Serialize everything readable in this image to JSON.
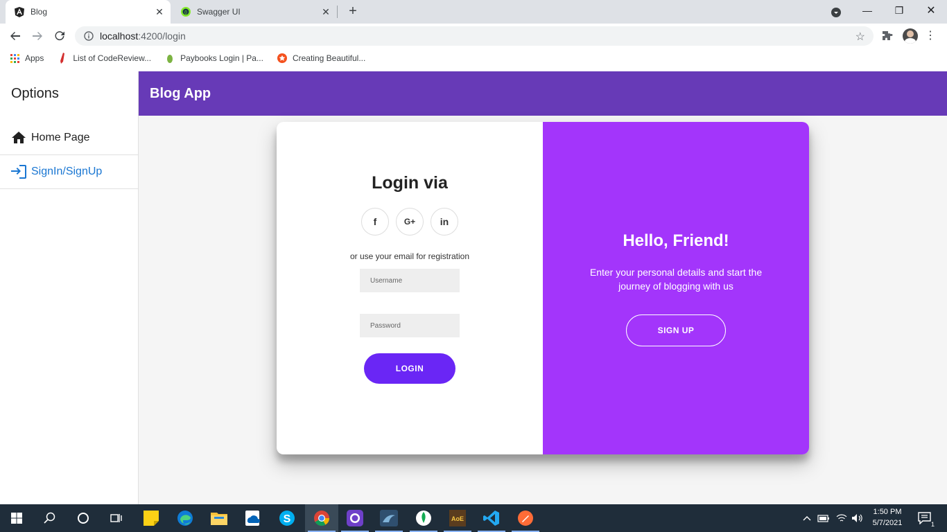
{
  "browser": {
    "tabs": [
      {
        "title": "Blog",
        "icon": "angular-icon",
        "active": true
      },
      {
        "title": "Swagger UI",
        "icon": "swagger-icon",
        "active": false
      }
    ],
    "url_host": "localhost",
    "url_path": ":4200/login",
    "bookmarks": [
      {
        "label": "Apps",
        "icon": "apps-grid-icon"
      },
      {
        "label": "List of CodeReview...",
        "icon": "red-pen-icon"
      },
      {
        "label": "Paybooks Login | Pa...",
        "icon": "leaf-icon"
      },
      {
        "label": "Creating Beautiful...",
        "icon": "star-badge-icon"
      }
    ]
  },
  "sidebar": {
    "title": "Options",
    "items": [
      {
        "label": "Home Page",
        "icon": "home-icon",
        "active": false
      },
      {
        "label": "SignIn/SignUp",
        "icon": "login-icon",
        "active": true
      }
    ]
  },
  "appbar": {
    "title": "Blog App"
  },
  "login": {
    "title": "Login via",
    "social": [
      "f",
      "G+",
      "in"
    ],
    "hint": "or use your email for registration",
    "username_placeholder": "Username",
    "password_placeholder": "Password",
    "button": "LOGIN"
  },
  "overlay": {
    "title": "Hello, Friend!",
    "text": "Enter your personal details and start the journey of blogging with us",
    "button": "SIGN UP"
  },
  "taskbar": {
    "time": "1:50 PM",
    "date": "5/7/2021",
    "notifications": "1"
  },
  "colors": {
    "appbar": "#673ab7",
    "overlay": "#a335fb",
    "login_button": "#6a26f5",
    "active_link": "#1976d2"
  }
}
